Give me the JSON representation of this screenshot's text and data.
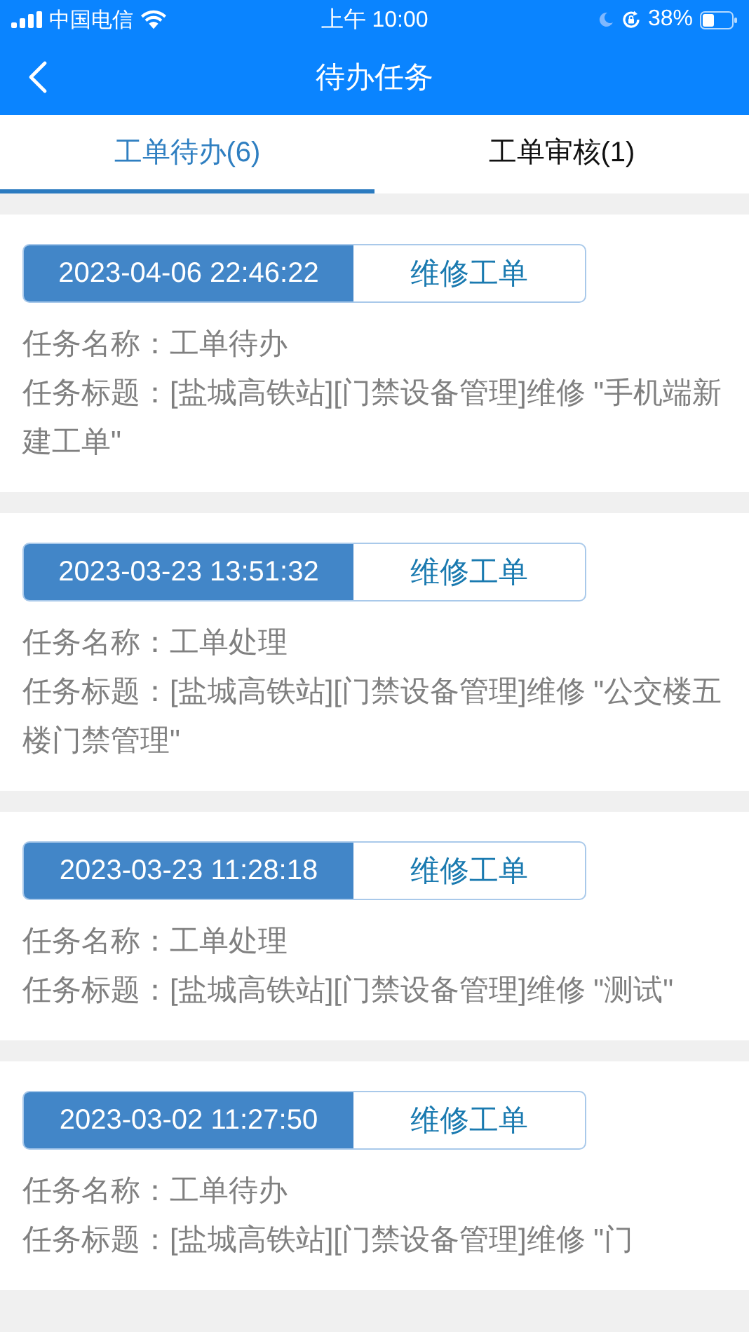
{
  "status_bar": {
    "carrier": "中国电信",
    "time": "上午 10:00",
    "battery": "38%"
  },
  "nav": {
    "title": "待办任务"
  },
  "tabs": [
    {
      "label": "工单待办(6)",
      "selected": true
    },
    {
      "label": "工单审核(1)",
      "selected": false
    }
  ],
  "tasks": [
    {
      "time": "2023-04-06 22:46:22",
      "type": "维修工单",
      "name": "任务名称：工单待办",
      "title": "任务标题：[盐城高铁站][门禁设备管理]维修 \"手机端新建工单\""
    },
    {
      "time": "2023-03-23 13:51:32",
      "type": "维修工单",
      "name": "任务名称：工单处理",
      "title": "任务标题：[盐城高铁站][门禁设备管理]维修 \"公交楼五楼门禁管理\""
    },
    {
      "time": "2023-03-23 11:28:18",
      "type": "维修工单",
      "name": "任务名称：工单处理",
      "title": "任务标题：[盐城高铁站][门禁设备管理]维修 \"测试\""
    },
    {
      "time": "2023-03-02 11:27:50",
      "type": "维修工单",
      "name": "任务名称：工单待办",
      "title": "任务标题：[盐城高铁站][门禁设备管理]维修 \"门"
    }
  ]
}
